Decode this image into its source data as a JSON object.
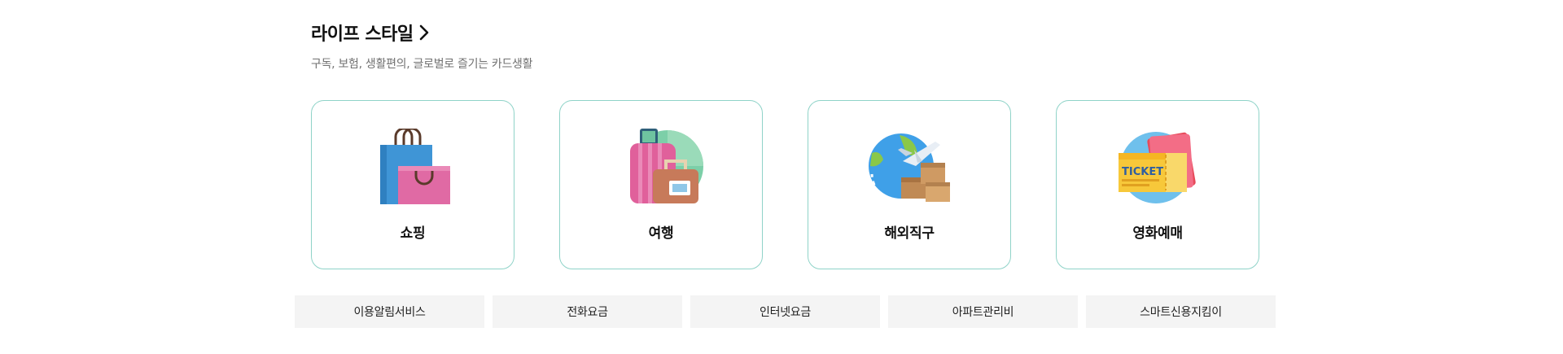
{
  "section": {
    "title": "라이프 스타일",
    "subtitle": "구독, 보험, 생활편의, 글로벌로 즐기는 카드생활"
  },
  "cards": [
    {
      "label": "쇼핑",
      "icon": "shopping-bags-icon"
    },
    {
      "label": "여행",
      "icon": "travel-luggage-icon"
    },
    {
      "label": "해외직구",
      "icon": "global-shipping-icon"
    },
    {
      "label": "영화예매",
      "icon": "movie-ticket-icon"
    }
  ],
  "ticket_text": "TICKET",
  "links": [
    {
      "label": "이용알림서비스"
    },
    {
      "label": "전화요금"
    },
    {
      "label": "인터넷요금"
    },
    {
      "label": "아파트관리비"
    },
    {
      "label": "스마트신용지킴이"
    }
  ],
  "colors": {
    "card_border": "#8fd3c8",
    "link_background": "#f4f4f4",
    "subtitle": "#707070"
  }
}
